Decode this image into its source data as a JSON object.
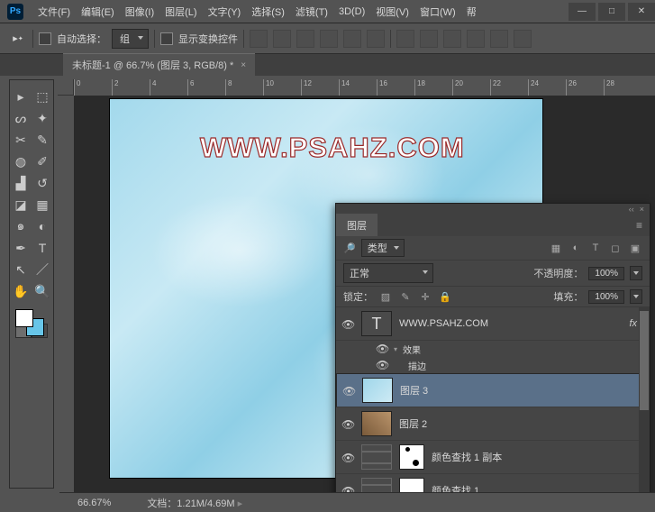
{
  "app": {
    "logo": "Ps"
  },
  "menu": [
    "文件(F)",
    "编辑(E)",
    "图像(I)",
    "图层(L)",
    "文字(Y)",
    "选择(S)",
    "滤镜(T)",
    "3D(D)",
    "视图(V)",
    "窗口(W)",
    "帮"
  ],
  "win_buttons": {
    "min": "—",
    "box": "□",
    "close": "✕"
  },
  "options": {
    "auto_select": "自动选择：",
    "group": "组",
    "show_transform": "显示变换控件"
  },
  "doc_tab": {
    "title": "未标题-1 @ 66.7% (图层 3, RGB/8) *",
    "close": "×"
  },
  "ruler_ticks": [
    0,
    2,
    4,
    6,
    8,
    10,
    12,
    14,
    16,
    18,
    20,
    22,
    24,
    26,
    28
  ],
  "canvas_text": "WWW.PSAHZ.COM",
  "layers_panel": {
    "title": "图层",
    "kind": "类型",
    "blend": "正常",
    "opacity_label": "不透明度：",
    "opacity_value": "100%",
    "lock_label": "锁定：",
    "fill_label": "填充：",
    "fill_value": "100%",
    "items": [
      {
        "type": "text",
        "name": "WWW.PSAHZ.COM",
        "fx": "fx"
      },
      {
        "type": "fx_group",
        "name": "效果"
      },
      {
        "type": "fx_item",
        "name": "描边"
      },
      {
        "type": "sky",
        "name": "图层 3",
        "selected": true
      },
      {
        "type": "photo",
        "name": "图层 2"
      },
      {
        "type": "adj",
        "name": "颜色查找 1 副本"
      },
      {
        "type": "adj",
        "name": "颜色查找 1"
      }
    ]
  },
  "status": {
    "zoom": "66.67%",
    "doc": "文档：1.21M/4.69M"
  }
}
